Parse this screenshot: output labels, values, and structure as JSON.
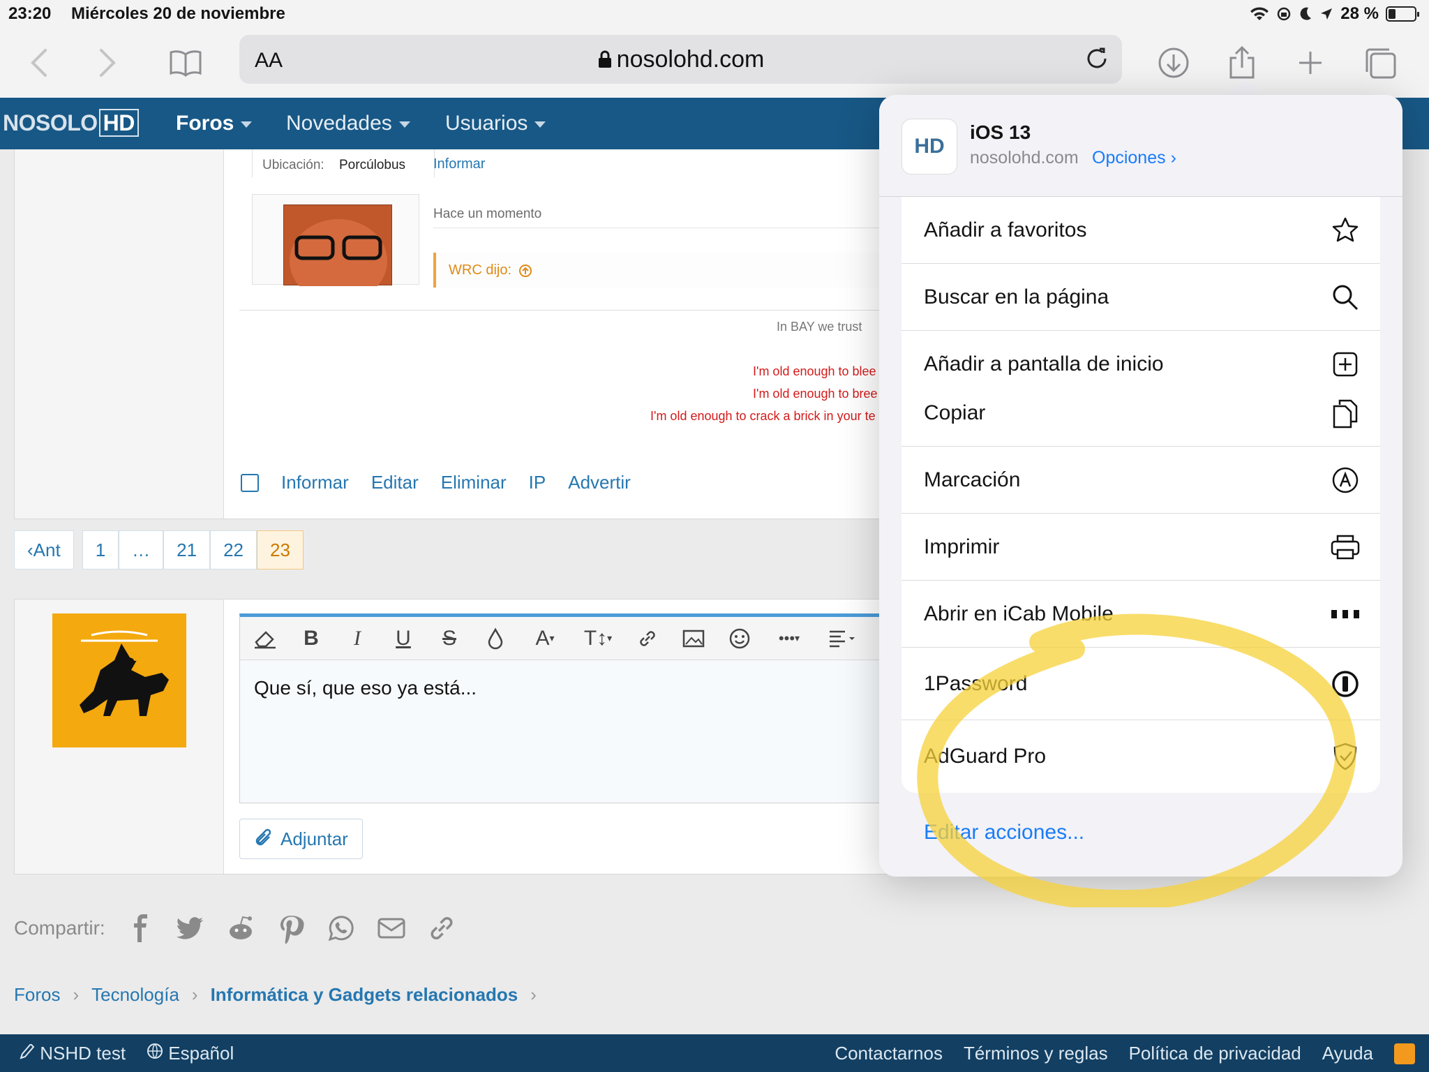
{
  "status": {
    "time": "23:20",
    "date": "Miércoles 20 de noviembre",
    "battery": "28 %",
    "battery_level": 0.28
  },
  "browser": {
    "aa_label": "AA",
    "url": "nosolohd.com"
  },
  "site": {
    "logo_no": "NOSOLO",
    "logo_hd": "HD",
    "nav": [
      {
        "label": "Foros"
      },
      {
        "label": "Novedades"
      },
      {
        "label": "Usuarios"
      }
    ]
  },
  "post": {
    "location_label": "Ubicación:",
    "location_value": "Porcúlobus",
    "report_link": "Informar",
    "time_ago": "Hace un momento",
    "quote_author": "WRC dijo:",
    "signature_1": "In BAY we trust",
    "signature_2": "I'm old enough to blee",
    "signature_3": "I'm old enough to bree",
    "signature_4": "I'm old enough to crack a brick in your te",
    "actions": [
      "Informar",
      "Editar",
      "Eliminar",
      "IP",
      "Advertir"
    ]
  },
  "pagination": {
    "prev": "Ant",
    "pages": [
      "1",
      "…",
      "21",
      "22",
      "23"
    ],
    "current": "23"
  },
  "reply": {
    "text": "Que sí, que eso ya está...",
    "attach": "Adjuntar"
  },
  "share_label": "Compartir:",
  "breadcrumb": [
    "Foros",
    "Tecnología",
    "Informática y Gadgets relacionados"
  ],
  "footer": {
    "left": [
      "NSHD test",
      "Español"
    ],
    "right": [
      "Contactarnos",
      "Términos y reglas",
      "Política de privacidad",
      "Ayuda"
    ]
  },
  "sheet": {
    "title": "iOS 13",
    "subtitle": "nosolohd.com",
    "options": "Opciones",
    "group1": [
      {
        "label": "Añadir a favoritos",
        "icon": "star-icon"
      },
      {
        "label": "Buscar en la página",
        "icon": "search-icon"
      },
      {
        "label": "Añadir a pantalla de inicio",
        "icon": "add-square-icon"
      }
    ],
    "group2": [
      {
        "label": "Copiar",
        "icon": "copy-icon"
      },
      {
        "label": "Marcación",
        "icon": "markup-icon"
      },
      {
        "label": "Imprimir",
        "icon": "print-icon"
      },
      {
        "label": "Abrir en iCab Mobile",
        "icon": "icab-icon"
      },
      {
        "label": "1Password",
        "icon": "1password-icon"
      },
      {
        "label": "AdGuard Pro",
        "icon": "adguard-icon"
      }
    ],
    "edit_actions": "Editar acciones..."
  }
}
